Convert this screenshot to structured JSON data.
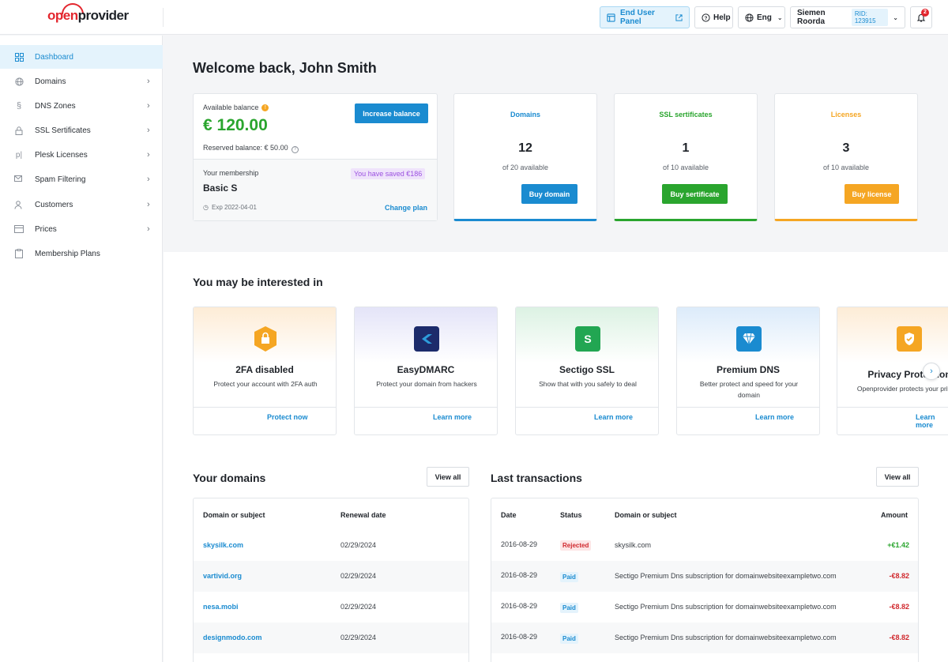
{
  "brand": {
    "logo_red": "open",
    "logo_dark": "provider"
  },
  "topbar": {
    "end_user_panel": "End User Panel",
    "help": "Help",
    "language": "Eng",
    "user_name": "Siemen Roorda",
    "rid": "RID: 123915",
    "notifications_count": "2"
  },
  "sidebar": {
    "items": [
      {
        "label": "Dashboard",
        "icon": "grid-icon",
        "active": true,
        "has_chevron": false
      },
      {
        "label": "Domains",
        "icon": "globe-icon",
        "has_chevron": true
      },
      {
        "label": "DNS Zones",
        "icon": "link-icon",
        "has_chevron": true
      },
      {
        "label": "SSL Sertificates",
        "icon": "lock-icon",
        "has_chevron": true
      },
      {
        "label": "Plesk Licenses",
        "icon": "plesk-icon",
        "has_chevron": true
      },
      {
        "label": "Spam Filtering",
        "icon": "mail-filter-icon",
        "has_chevron": true
      },
      {
        "label": "Customers",
        "icon": "users-icon",
        "has_chevron": true
      },
      {
        "label": "Prices",
        "icon": "price-tag-icon",
        "has_chevron": true
      },
      {
        "label": "Membership Plans",
        "icon": "membership-icon",
        "has_chevron": false
      }
    ]
  },
  "welcome": "Welcome back, John Smith",
  "balance": {
    "label": "Available balance",
    "amount": "€ 120.00",
    "increase_button": "Increase balance",
    "reserved": "Reserved balance: € 50.00",
    "membership_label": "Your membership",
    "saved_badge": "You have saved €186",
    "plan": "Basic S",
    "expires": "Exp 2022-04-01",
    "change_plan": "Change plan"
  },
  "stats": [
    {
      "title": "Domains",
      "count": "12",
      "sub": "of 20 available",
      "button": "Buy domain",
      "color": "#1a8bd0"
    },
    {
      "title": "SSL sertificates",
      "count": "1",
      "sub": "of 10 available",
      "button": "Buy sertificate",
      "color": "#2aa52e"
    },
    {
      "title": "Licenses",
      "count": "3",
      "sub": "of 10 available",
      "button": "Buy license",
      "color": "#f5a623"
    }
  ],
  "interested": {
    "title": "You may be interested in",
    "cards": [
      {
        "title": "2FA disabled",
        "desc": "Protect your account with 2FA auth",
        "link": "Protect now",
        "icon": "shield-lock-icon"
      },
      {
        "title": "EasyDMARC",
        "desc": "Protect your domain from hackers",
        "link": "Learn more",
        "icon": "easydmarc-logo-icon"
      },
      {
        "title": "Sectigo SSL",
        "desc": "Show that with you safely to deal",
        "link": "Learn more",
        "icon": "sectigo-logo-icon"
      },
      {
        "title": "Premium DNS",
        "desc": "Better protect and speed for your domain",
        "link": "Learn more",
        "icon": "diamond-icon"
      },
      {
        "title": "Privacy Protection",
        "desc": "Openprovider protects your privacy",
        "link": "Learn more",
        "icon": "shield-check-icon"
      }
    ]
  },
  "domains": {
    "title": "Your domains",
    "view_all": "View all",
    "headers": [
      "Domain or subject",
      "Renewal date"
    ],
    "rows": [
      {
        "domain": "skysilk.com",
        "date": "02/29/2024"
      },
      {
        "domain": "vartivid.org",
        "date": "02/29/2024"
      },
      {
        "domain": "nesa.mobi",
        "date": "02/29/2024"
      },
      {
        "domain": "designmodo.com",
        "date": "02/29/2024"
      }
    ]
  },
  "transactions": {
    "title": "Last transactions",
    "view_all": "View all",
    "headers": [
      "Date",
      "Status",
      "Domain or subject",
      "Amount"
    ],
    "rows": [
      {
        "date": "2016-08-29",
        "status": "Rejected",
        "subject": "skysilk.com",
        "amount": "+€1.42"
      },
      {
        "date": "2016-08-29",
        "status": "Paid",
        "subject": "Sectigo Premium Dns subscription for domainwebsiteexampletwo.com",
        "amount": "-€8.82"
      },
      {
        "date": "2016-08-29",
        "status": "Paid",
        "subject": "Sectigo Premium Dns subscription for domainwebsiteexampletwo.com",
        "amount": "-€8.82"
      },
      {
        "date": "2016-08-29",
        "status": "Paid",
        "subject": "Sectigo Premium Dns subscription for domainwebsiteexampletwo.com",
        "amount": "-€8.82"
      }
    ]
  },
  "colors": {
    "accent": "#1a8bd0",
    "success": "#2aa52e",
    "warning": "#f5a623",
    "danger": "#d0282d"
  }
}
